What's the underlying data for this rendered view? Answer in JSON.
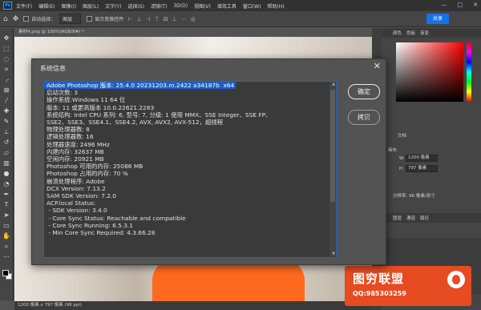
{
  "app": {
    "logo": "Ps",
    "menu": [
      "文件(F)",
      "编辑(E)",
      "图像(I)",
      "图层(L)",
      "文字(Y)",
      "选择(S)",
      "滤镜(T)",
      "3D(D)",
      "视图(V)",
      "增效工具",
      "窗口(W)",
      "帮助(H)"
    ],
    "window_controls": [
      "—",
      "□",
      "✕"
    ]
  },
  "options_bar": {
    "auto_select_label": "自动选择：",
    "auto_select_value": "图层",
    "show_transform_label": "显示变换控件",
    "share_label": "共享"
  },
  "document": {
    "tab_label": "素材4.png @ 100%(RGB/8#) *",
    "status": "1200 像素 x 797 像素 (96 ppi)"
  },
  "panels": {
    "tabs": [
      "颜色",
      "色板",
      "渐变"
    ],
    "doc_label": "文档",
    "canvas_label": "画布",
    "width_label": "W",
    "width_value": "1200 像素",
    "height_label": "H",
    "height_value": "797 像素",
    "resolution_label": "分辨率: 96 像素/英寸",
    "layers_tabs": [
      "图层",
      "通道",
      "路径"
    ]
  },
  "dialog": {
    "title": "系统信息",
    "close": "✕",
    "ok_label": "确定",
    "copy_label": "拷贝",
    "lines": [
      "Adobe Photoshop 版本: 25.4.0 20231203.m.2422 a34187b  x64",
      "启动次数: 3",
      "操作系统:Windows 11 64 位",
      "版本: 11 或更高版本 10.0.22621.2283",
      "系统结构: Intel CPU 系列: 6, 型号: 7, 分级: 1 使用 MMX、SSE Integer、SSE FP、",
      "SSE2、SSE3、SSE4.1、SSE4.2, AVX, AVX2, AVX-512，超线程",
      "物理处理器数: 8",
      "逻辑处理器数: 16",
      "处理器速度: 2496 MHz",
      "内建内存: 32637 MB",
      "空闲内存: 20921 MB",
      "Photoshop 可用的内存: 25086 MB",
      "Photoshop 占用的内存: 70 %",
      "崩溃处理程序: Adobe",
      "DCX Version: 7.13.2",
      "SAM SDK Version: 7.2.0",
      "ACP.local Status:",
      " - SDK Version: 3.4.0",
      " - Core Sync Status: Reachable and compatible",
      " - Core Sync Running: 6.5.3.1",
      " - Min Core Sync Required: 4.3.66.28"
    ]
  },
  "watermark": {
    "text": "图穷联盟",
    "qq": "QQ:985303259"
  },
  "colors": {
    "accent": "#1473e6",
    "selection": "#1c5fc7",
    "watermark": "#e64b22"
  }
}
